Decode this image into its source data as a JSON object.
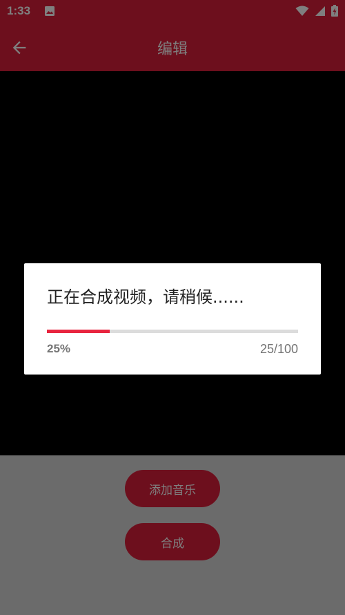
{
  "status_bar": {
    "time": "1:33",
    "icons": [
      "image-icon",
      "wifi-icon",
      "signal-icon",
      "battery-charging-icon"
    ]
  },
  "app_bar": {
    "title": "编辑",
    "back_icon": "arrow-left-icon"
  },
  "actions": {
    "add_music_label": "添加音乐",
    "compose_label": "合成"
  },
  "progress_dialog": {
    "message": "正在合成视频，请稍候......",
    "progress_fraction": 0.25,
    "percent_text": "25%",
    "count_text": "25/100"
  },
  "colors": {
    "primary": "#da1f3a",
    "progress": "#e8253f",
    "video_background": "#000000"
  }
}
